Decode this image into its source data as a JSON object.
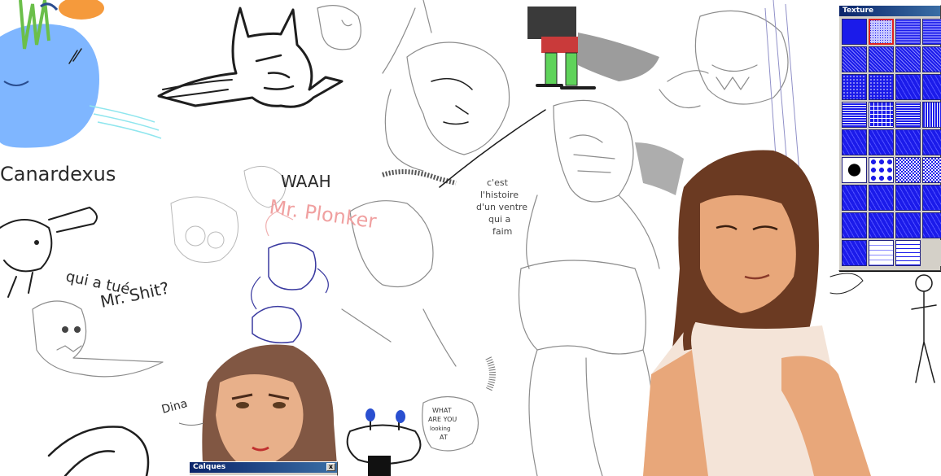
{
  "texture_panel": {
    "title": "Texture",
    "swatches": [
      "solid",
      "dots-fine",
      "grid-fine",
      "grid-fine",
      "crosshatch",
      "crosshatch",
      "crosshatch",
      "crosshatch",
      "dots",
      "dots",
      "noise",
      "noise",
      "stripes-horizontal",
      "grid-mid",
      "stripes-horizontal",
      "stripes-vertical",
      "noise",
      "noise",
      "noise",
      "noise",
      "big-dots",
      "big-dots-pattern",
      "checker",
      "checker",
      "noise",
      "noise",
      "noise",
      "noise",
      "noise",
      "noise",
      "noise",
      "noise",
      "noise",
      "white-grid",
      "grid-thin",
      ""
    ]
  },
  "layers_panel": {
    "title": "Calques",
    "close_label": "x"
  },
  "sketch_texts": {
    "canardexus": "Canardexus",
    "qui_a_tue": "qui a tué",
    "mr_shit": "Mr. Shit?",
    "waah": "WAAH",
    "mr_plonker": "Mr. Plonker",
    "histoire_1": "c'est",
    "histoire_2": "l'histoire",
    "histoire_3": "d'un ventre",
    "histoire_4": "qui a",
    "histoire_5": "faim",
    "dina": "Dina",
    "what_1": "WHAT",
    "what_2": "ARE YOU",
    "what_3": "looking",
    "what_4": "AT"
  },
  "colors": {
    "texture_blue": "#1b1bea",
    "skin_tone": "#e8a77a",
    "hair_brown": "#6b3a22",
    "duck_blue": "#7fb6ff",
    "boot_green": "#5fd35a"
  }
}
